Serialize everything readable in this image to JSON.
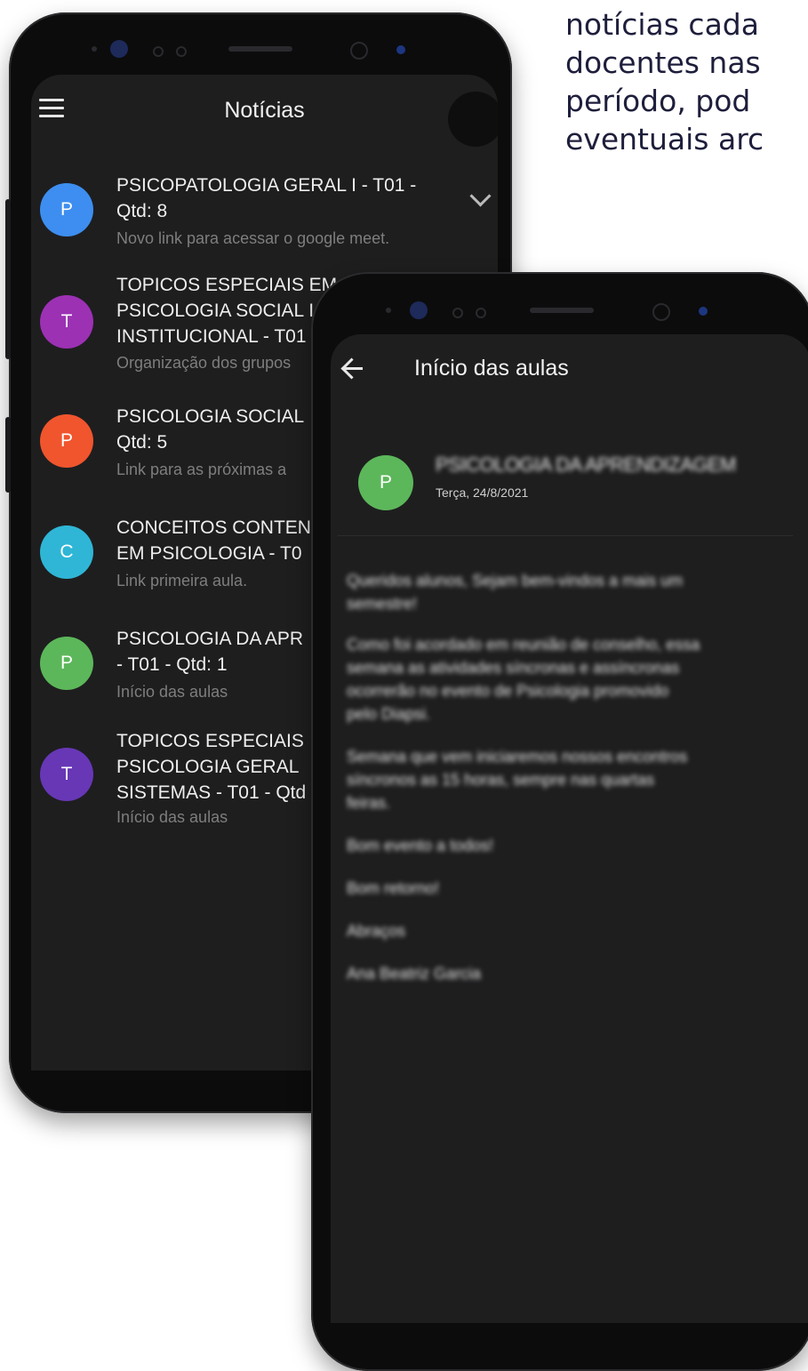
{
  "side_text": [
    "notícias cada",
    "docentes nas",
    "período, pod",
    "eventuais arc"
  ],
  "news_list": {
    "title": "Notícias",
    "items": [
      {
        "letter": "P",
        "color": "#3d8ef0",
        "title_lines": [
          "PSICOPATOLOGIA GERAL I - T01 -",
          "Qtd: 8"
        ],
        "subtitle": "Novo link para acessar o google meet."
      },
      {
        "letter": "T",
        "color": "#9c31b4",
        "title_lines": [
          "TOPICOS ESPECIAIS EM",
          "PSICOLOGIA SOCIAL I",
          "INSTITUCIONAL - T01"
        ],
        "subtitle": "Organização dos grupos"
      },
      {
        "letter": "P",
        "color": "#f0552d",
        "title_lines": [
          "PSICOLOGIA SOCIAL",
          "Qtd: 5"
        ],
        "subtitle": "Link para as próximas a"
      },
      {
        "letter": "C",
        "color": "#2fb6d6",
        "title_lines": [
          "CONCEITOS CONTEN",
          "EM PSICOLOGIA - T0"
        ],
        "subtitle": "Link primeira aula."
      },
      {
        "letter": "P",
        "color": "#5cb75a",
        "title_lines": [
          "PSICOLOGIA DA APR",
          "- T01 - Qtd: 1"
        ],
        "subtitle": "Início das aulas"
      },
      {
        "letter": "T",
        "color": "#6737b6",
        "title_lines": [
          "TOPICOS ESPECIAIS",
          "PSICOLOGIA GERAL",
          "SISTEMAS - T01 - Qtd"
        ],
        "subtitle": "Início das aulas"
      }
    ]
  },
  "detail": {
    "title": "Início das aulas",
    "avatar_letter": "P",
    "course": "PSICOLOGIA DA APRENDIZAGEM",
    "date": "Terça, 24/8/2021",
    "paragraphs": [
      [
        "Queridos alunos, Sejam bem-vindos a mais um",
        "semestre!"
      ],
      [
        "Como foi acordado em reunião de conselho, essa",
        "semana as atividades síncronas e assíncronas",
        "ocorrerão no evento de Psicologia promovido",
        "pelo Diapsi."
      ],
      [
        "Semana que vem iniciaremos nossos encontros",
        "síncronos as 15 horas, sempre nas quartas",
        "feiras."
      ],
      [
        "Bom evento a todos!"
      ],
      [
        "Bom retorno!"
      ],
      [
        "Abraços"
      ],
      [
        "Ana Beatriz Garcia"
      ]
    ]
  }
}
